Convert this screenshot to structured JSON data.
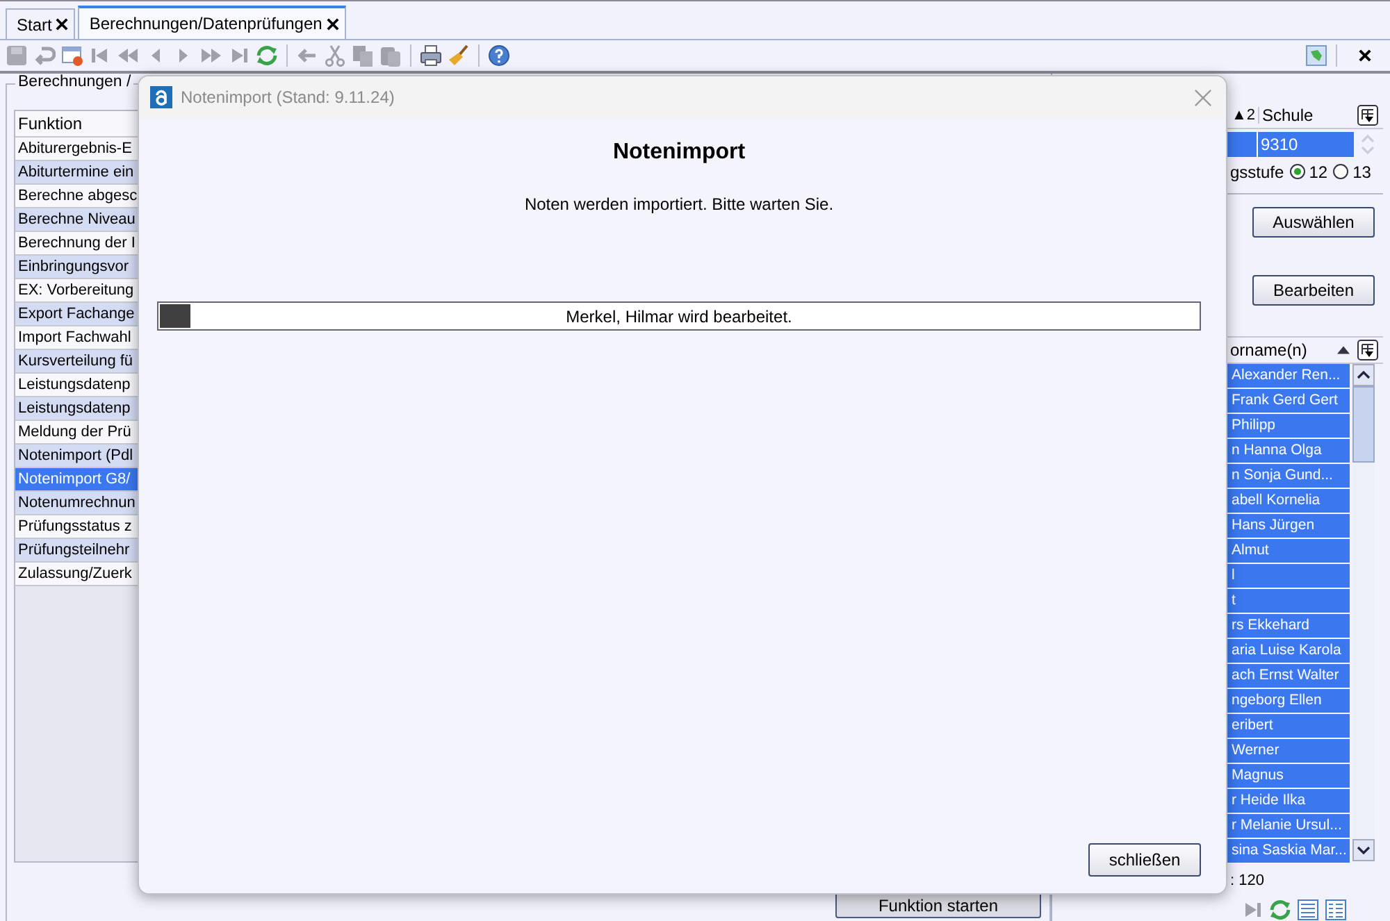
{
  "tabs": [
    {
      "label": "Start",
      "selected": false
    },
    {
      "label": "Berechnungen/Datenprüfungen",
      "selected": true
    }
  ],
  "left_panel": {
    "group_label": "Berechnungen /",
    "column_header": "Funktion",
    "items": [
      {
        "label": "Abiturergebnis-E",
        "selected": false
      },
      {
        "label": "Abiturtermine ein",
        "selected": false
      },
      {
        "label": "Berechne abgesc",
        "selected": false
      },
      {
        "label": "Berechne Niveau",
        "selected": false
      },
      {
        "label": "Berechnung der I",
        "selected": false
      },
      {
        "label": "Einbringungsvor",
        "selected": false
      },
      {
        "label": "EX: Vorbereitung",
        "selected": false
      },
      {
        "label": "Export Fachange",
        "selected": false
      },
      {
        "label": "Import Fachwahl",
        "selected": false
      },
      {
        "label": "Kursverteilung fü",
        "selected": false
      },
      {
        "label": "Leistungsdatenp",
        "selected": false
      },
      {
        "label": "Leistungsdatenp",
        "selected": false
      },
      {
        "label": "Meldung der Prü",
        "selected": false
      },
      {
        "label": "Notenimport (Pdl",
        "selected": false
      },
      {
        "label": "Notenimport G8/",
        "selected": true
      },
      {
        "label": "Notenumrechnun",
        "selected": false
      },
      {
        "label": "Prüfungsstatus z",
        "selected": false
      },
      {
        "label": "Prüfungsteilnehr",
        "selected": false
      },
      {
        "label": "Zulassung/Zuerk",
        "selected": false
      }
    ],
    "start_button": "Funktion starten"
  },
  "right_panel": {
    "sort_label": "▲2",
    "column_header": "Schule",
    "school_value": "9310",
    "grade_label": "gsstufe",
    "grade_options": [
      {
        "label": "12",
        "selected": true
      },
      {
        "label": "13",
        "selected": false
      }
    ],
    "buttons": [
      "Auswählen",
      "Bearbeiten"
    ],
    "names_header": "orname(n)",
    "names": [
      "Alexander Ren...",
      "Frank Gerd Gert",
      "Philipp",
      "n Hanna Olga",
      "n Sonja Gund...",
      "abell Kornelia",
      "Hans Jürgen",
      "Almut",
      "l",
      "t",
      "rs Ekkehard",
      "aria Luise Karola",
      "ach Ernst Walter",
      "ngeborg Ellen",
      "eribert",
      "Werner",
      "Magnus",
      "r Heide Ilka",
      "r Melanie Ursul...",
      "sina Saskia Mar..."
    ],
    "count": ": 120"
  },
  "dialog": {
    "title": "Notenimport (Stand: 9.11.24)",
    "heading": "Notenimport",
    "message": "Noten werden importiert. Bitte warten Sie.",
    "progress": {
      "level": 0.03,
      "text": "Merkel, Hilmar wird bearbeitet."
    },
    "close_button": "schließen"
  }
}
